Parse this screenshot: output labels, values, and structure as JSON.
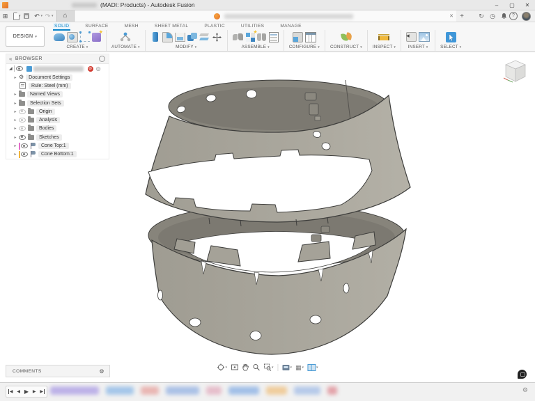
{
  "titlebar": {
    "title": "(MADI: Products) - Autodesk Fusion",
    "minimize_glyph": "–",
    "maximize_glyph": "▢",
    "close_glyph": "✕"
  },
  "quickbar": {
    "app_menu_glyph": "⊞",
    "undo_glyph": "↶",
    "redo_glyph": "↷",
    "home_glyph": "⌂",
    "tab_close_glyph": "✕",
    "new_tab_glyph": "+",
    "sync_glyph": "↻",
    "clock_glyph": "◷",
    "help_glyph": "?"
  },
  "ribbon": {
    "design_button_label": "DESIGN",
    "dropdown_glyph": "▾",
    "tabs": [
      {
        "label": "SOLID",
        "active": true
      },
      {
        "label": "SURFACE"
      },
      {
        "label": "MESH"
      },
      {
        "label": "SHEET METAL"
      },
      {
        "label": "PLASTIC"
      },
      {
        "label": "UTILITIES"
      },
      {
        "label": "MANAGE"
      }
    ],
    "groups": [
      {
        "label": "CREATE"
      },
      {
        "label": "AUTOMATE"
      },
      {
        "label": "MODIFY"
      },
      {
        "label": "ASSEMBLE"
      },
      {
        "label": "CONFIGURE"
      },
      {
        "label": "CONSTRUCT"
      },
      {
        "label": "INSPECT"
      },
      {
        "label": "INSERT"
      },
      {
        "label": "SELECT"
      }
    ]
  },
  "browser": {
    "title": "BROWSER",
    "collapse_glyph": "«",
    "root_expand_glyph": "◢",
    "expand_glyph": "▸",
    "error_badge_glyph": "⊘",
    "target_glyph": "◎",
    "items": [
      {
        "label": "Document Settings",
        "icon": "gear"
      },
      {
        "label": "Rule: Steel (mm)",
        "icon": "rule"
      },
      {
        "label": "Named Views",
        "icon": "folder"
      },
      {
        "label": "Selection Sets",
        "icon": "folder"
      },
      {
        "label": "Origin",
        "icon": "folder",
        "eye": "dim"
      },
      {
        "label": "Analysis",
        "icon": "folder",
        "eye": "dim"
      },
      {
        "label": "Bodies",
        "icon": "folder",
        "eye": "dim"
      },
      {
        "label": "Sketches",
        "icon": "folder",
        "eye": "visible"
      },
      {
        "label": "Cone Top:1",
        "icon": "component",
        "eye": "visible",
        "tag_color": "#e36cc8"
      },
      {
        "label": "Cone Bottom:1",
        "icon": "component",
        "eye": "visible",
        "tag_color": "#f2b53c"
      }
    ]
  },
  "comments": {
    "title": "COMMENTS",
    "gear_glyph": "⚙"
  },
  "timeline": {
    "skip_start_glyph": "◀",
    "step_back_glyph": "◀",
    "play_glyph": "▶",
    "step_forward_glyph": "▶",
    "skip_end_glyph": "▶",
    "settings_gear_glyph": "⚙"
  },
  "navbar": {
    "grid_glyph": "▦",
    "dropdown_glyph": "▾"
  },
  "colors": {
    "accent_blue": "#0a84c9",
    "select_blue": "#3f97d9",
    "model_outer_gray": "#a8a59b",
    "model_inner_gray": "#87847b",
    "cone_top_tag": "#e36cc8",
    "cone_bottom_tag": "#f2b53c",
    "fusion_orange": "#e2702a"
  }
}
